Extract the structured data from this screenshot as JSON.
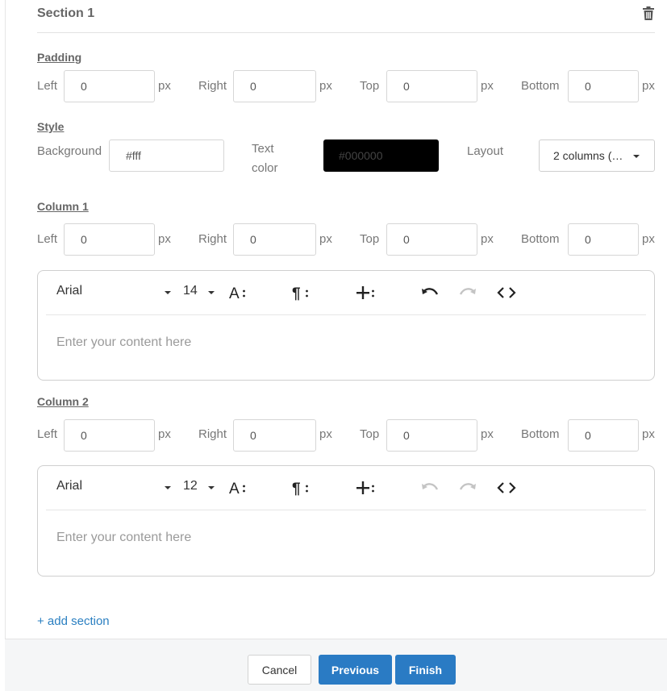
{
  "section": {
    "title": "Section 1",
    "delete_icon": "trash-icon"
  },
  "padding": {
    "heading": "Padding",
    "left_label": "Left",
    "left_value": "0",
    "right_label": "Right",
    "right_value": "0",
    "top_label": "Top",
    "top_value": "0",
    "bottom_label": "Bottom",
    "bottom_value": "0",
    "unit": "px"
  },
  "style": {
    "heading": "Style",
    "background_label": "Background",
    "background_value": "#fff",
    "text_color_label_1": "Text",
    "text_color_label_2": "color",
    "text_color_value": "#000000",
    "text_color_swatch": "#000000",
    "layout_label": "Layout",
    "layout_value": "2 columns (…"
  },
  "column1": {
    "heading": "Column 1",
    "left_label": "Left",
    "left_value": "0",
    "right_label": "Right",
    "right_value": "0",
    "top_label": "Top",
    "top_value": "0",
    "bottom_label": "Bottom",
    "bottom_value": "0",
    "unit": "px",
    "editor": {
      "font": "Arial",
      "size": "14",
      "placeholder": "Enter your content here",
      "undo_enabled": true,
      "redo_enabled": false
    }
  },
  "column2": {
    "heading": "Column 2",
    "left_label": "Left",
    "left_value": "0",
    "right_label": "Right",
    "right_value": "0",
    "top_label": "Top",
    "top_value": "0",
    "bottom_label": "Bottom",
    "bottom_value": "0",
    "unit": "px",
    "editor": {
      "font": "Arial",
      "size": "12",
      "placeholder": "Enter your content here",
      "undo_enabled": false,
      "redo_enabled": false
    }
  },
  "add_section": "+ add section",
  "footer": {
    "cancel": "Cancel",
    "previous": "Previous",
    "finish": "Finish"
  },
  "colors": {
    "accent": "#2a7bc4",
    "link": "#2a7fc1"
  }
}
